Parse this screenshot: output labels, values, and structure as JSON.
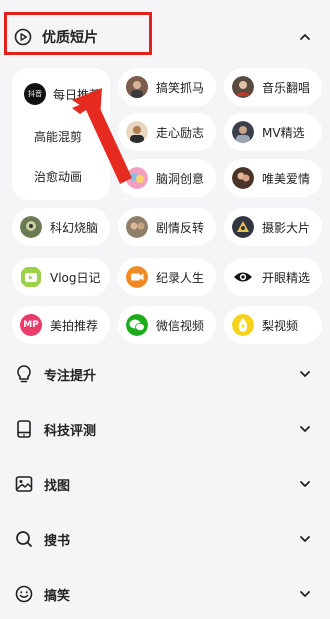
{
  "header": {
    "title": "优质短片",
    "play_icon": "play-circle-icon",
    "collapse_icon": "chevron-up-icon"
  },
  "featured": {
    "daily": {
      "label": "每日推荐",
      "badge": "抖音"
    },
    "energy": {
      "label": "高能混剪"
    },
    "healing": {
      "label": "治愈动画"
    }
  },
  "tiles": [
    {
      "label": "搞笑抓马",
      "icon": "funny-avatar-icon"
    },
    {
      "label": "音乐翻唱",
      "icon": "music-avatar-icon"
    },
    {
      "label": "走心励志",
      "icon": "inspire-avatar-icon"
    },
    {
      "label": "MV精选",
      "icon": "mv-avatar-icon"
    },
    {
      "label": "脑洞创意",
      "icon": "creative-avatar-icon"
    },
    {
      "label": "唯美爱情",
      "icon": "love-avatar-icon"
    },
    {
      "label": "科幻烧脑",
      "icon": "scifi-avatar-icon"
    },
    {
      "label": "剧情反转",
      "icon": "plot-avatar-icon"
    },
    {
      "label": "摄影大片",
      "icon": "photo-avatar-icon"
    },
    {
      "label": "Vlog日记",
      "icon": "vlog-icon"
    },
    {
      "label": "纪录人生",
      "icon": "record-icon"
    },
    {
      "label": "开眼精选",
      "icon": "eye-icon"
    },
    {
      "label": "美拍推荐",
      "icon": "meipai-icon",
      "badge": "MP"
    },
    {
      "label": "微信视频",
      "icon": "wechat-icon"
    },
    {
      "label": "梨视频",
      "icon": "pear-video-icon"
    }
  ],
  "sections": [
    {
      "label": "专注提升",
      "icon": "lightbulb-icon"
    },
    {
      "label": "科技评测",
      "icon": "tablet-icon"
    },
    {
      "label": "找图",
      "icon": "image-icon"
    },
    {
      "label": "搜书",
      "icon": "search-icon"
    },
    {
      "label": "搞笑",
      "icon": "smile-icon"
    }
  ],
  "colors": {
    "highlight": "#e0221b",
    "background": "#f5f5f7",
    "tile": "#ffffff"
  }
}
